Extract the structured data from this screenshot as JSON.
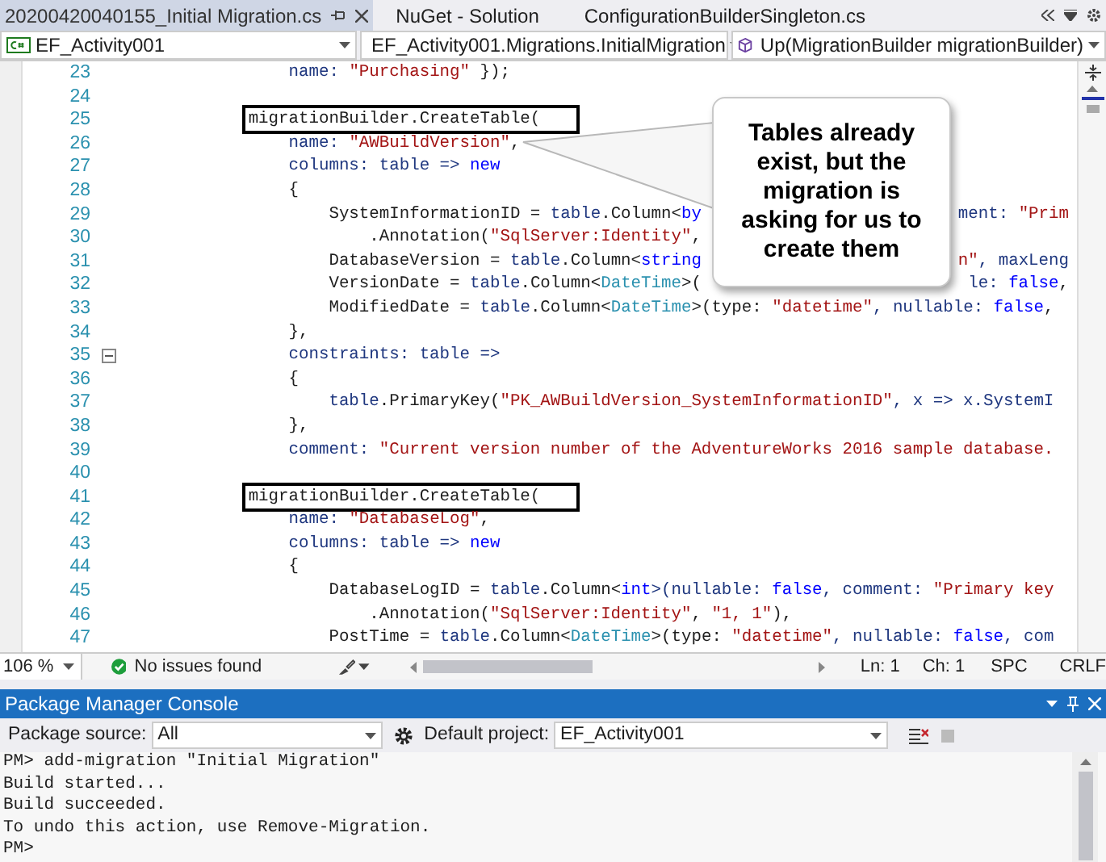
{
  "tabs": [
    {
      "label": "20200420040155_Initial Migration.cs",
      "selected": true
    },
    {
      "label": "NuGet - Solution",
      "selected": false
    },
    {
      "label": "ConfigurationBuilderSingleton.cs",
      "selected": false
    }
  ],
  "navigation": [
    {
      "kind": "project",
      "text": "EF_Activity001"
    },
    {
      "kind": "class",
      "text": "EF_Activity001.Migrations.InitialMigration"
    },
    {
      "kind": "method",
      "text": "Up(MigrationBuilder migrationBuilder)"
    }
  ],
  "editor": {
    "lines": [
      {
        "number": "23",
        "fold": false,
        "boxed": false,
        "segments": [
          {
            "text": "                name: ",
            "kind": "param"
          },
          {
            "text": "\"Purchasing\"",
            "kind": "str"
          },
          {
            "text": " });",
            "kind": "plain"
          }
        ]
      },
      {
        "number": "24",
        "fold": false,
        "boxed": false
      },
      {
        "number": "25",
        "fold": false,
        "boxed": true,
        "segments": [
          {
            "text": "            migrationBuilder.CreateTable(",
            "kind": "plain"
          }
        ]
      },
      {
        "number": "26",
        "fold": false,
        "boxed": false,
        "segments": [
          {
            "text": "                name: ",
            "kind": "param"
          },
          {
            "text": "\"AWBuildVersion\"",
            "kind": "str"
          },
          {
            "text": ",",
            "kind": "plain"
          }
        ]
      },
      {
        "number": "27",
        "fold": false,
        "boxed": false,
        "segments": [
          {
            "text": "                columns: table => ",
            "kind": "param"
          },
          {
            "text": "new",
            "kind": "kw"
          }
        ]
      },
      {
        "number": "28",
        "fold": false,
        "boxed": false,
        "segments": [
          {
            "text": "                {",
            "kind": "plain"
          }
        ]
      },
      {
        "number": "29",
        "fold": false,
        "boxed": false,
        "segments": [
          {
            "text": "                    SystemInformationID = ",
            "kind": "plain"
          },
          {
            "text": "table",
            "kind": "param"
          },
          {
            "text": ".Column<",
            "kind": "plain"
          },
          {
            "text": "by",
            "kind": "kw"
          }
        ],
        "right_segments": [
          {
            "text": "ment: ",
            "kind": "param"
          },
          {
            "text": "\"Prim",
            "kind": "str"
          }
        ]
      },
      {
        "number": "30",
        "fold": false,
        "boxed": false,
        "segments": [
          {
            "text": "                        .Annotation(",
            "kind": "plain"
          },
          {
            "text": "\"SqlServer:Identity\"",
            "kind": "str"
          },
          {
            "text": ",",
            "kind": "plain"
          }
        ]
      },
      {
        "number": "31",
        "fold": false,
        "boxed": false,
        "segments": [
          {
            "text": "                    DatabaseVersion = ",
            "kind": "plain"
          },
          {
            "text": "table",
            "kind": "param"
          },
          {
            "text": ".Column<",
            "kind": "plain"
          },
          {
            "text": "string",
            "kind": "kw"
          }
        ],
        "right_segments": [
          {
            "text": "n\"",
            "kind": "str"
          },
          {
            "text": ", maxLeng",
            "kind": "param"
          }
        ]
      },
      {
        "number": "32",
        "fold": false,
        "boxed": false,
        "segments": [
          {
            "text": "                    VersionDate = ",
            "kind": "plain"
          },
          {
            "text": "table",
            "kind": "param"
          },
          {
            "text": ".Column<",
            "kind": "plain"
          },
          {
            "text": "DateTime",
            "kind": "type"
          },
          {
            "text": ">(",
            "kind": "plain"
          }
        ],
        "right_segments": [
          {
            "text": "le: ",
            "kind": "param"
          },
          {
            "text": "false",
            "kind": "kw"
          },
          {
            "text": ",",
            "kind": "plain"
          }
        ]
      },
      {
        "number": "33",
        "fold": false,
        "boxed": false,
        "segments": [
          {
            "text": "                    ModifiedDate = ",
            "kind": "plain"
          },
          {
            "text": "table",
            "kind": "param"
          },
          {
            "text": ".Column<",
            "kind": "plain"
          },
          {
            "text": "DateTime",
            "kind": "type"
          },
          {
            "text": ">(type: ",
            "kind": "plain"
          },
          {
            "text": "\"datetime\"",
            "kind": "str"
          },
          {
            "text": ", nullable: ",
            "kind": "param"
          },
          {
            "text": "false",
            "kind": "kw"
          },
          {
            "text": ",",
            "kind": "plain"
          }
        ]
      },
      {
        "number": "34",
        "fold": false,
        "boxed": false,
        "segments": [
          {
            "text": "                },",
            "kind": "plain"
          }
        ]
      },
      {
        "number": "35",
        "fold": true,
        "boxed": false,
        "segments": [
          {
            "text": "                constraints: table =>",
            "kind": "param"
          }
        ]
      },
      {
        "number": "36",
        "fold": false,
        "boxed": false,
        "segments": [
          {
            "text": "                {",
            "kind": "plain"
          }
        ]
      },
      {
        "number": "37",
        "fold": false,
        "boxed": false,
        "segments": [
          {
            "text": "                    table",
            "kind": "param"
          },
          {
            "text": ".PrimaryKey(",
            "kind": "plain"
          },
          {
            "text": "\"PK_AWBuildVersion_SystemInformationID\"",
            "kind": "str"
          },
          {
            "text": ", x => x.SystemI",
            "kind": "param"
          }
        ]
      },
      {
        "number": "38",
        "fold": false,
        "boxed": false,
        "segments": [
          {
            "text": "                },",
            "kind": "plain"
          }
        ]
      },
      {
        "number": "39",
        "fold": false,
        "boxed": false,
        "segments": [
          {
            "text": "                comment: ",
            "kind": "param"
          },
          {
            "text": "\"Current version number of the AdventureWorks 2016 sample database.",
            "kind": "str"
          }
        ]
      },
      {
        "number": "40",
        "fold": false,
        "boxed": false
      },
      {
        "number": "41",
        "fold": false,
        "boxed": true,
        "segments": [
          {
            "text": "            migrationBuilder.CreateTable(",
            "kind": "plain"
          }
        ]
      },
      {
        "number": "42",
        "fold": false,
        "boxed": false,
        "segments": [
          {
            "text": "                name: ",
            "kind": "param"
          },
          {
            "text": "\"DatabaseLog\"",
            "kind": "str"
          },
          {
            "text": ",",
            "kind": "plain"
          }
        ]
      },
      {
        "number": "43",
        "fold": false,
        "boxed": false,
        "segments": [
          {
            "text": "                columns: table => ",
            "kind": "param"
          },
          {
            "text": "new",
            "kind": "kw"
          }
        ]
      },
      {
        "number": "44",
        "fold": false,
        "boxed": false,
        "segments": [
          {
            "text": "                {",
            "kind": "plain"
          }
        ]
      },
      {
        "number": "45",
        "fold": false,
        "boxed": false,
        "segments": [
          {
            "text": "                    DatabaseLogID = ",
            "kind": "plain"
          },
          {
            "text": "table",
            "kind": "param"
          },
          {
            "text": ".Column<",
            "kind": "plain"
          },
          {
            "text": "int",
            "kind": "kw"
          },
          {
            "text": ">(nullable: ",
            "kind": "param"
          },
          {
            "text": "false",
            "kind": "kw"
          },
          {
            "text": ", comment: ",
            "kind": "param"
          },
          {
            "text": "\"Primary key",
            "kind": "str"
          }
        ]
      },
      {
        "number": "46",
        "fold": false,
        "boxed": false,
        "segments": [
          {
            "text": "                        .Annotation(",
            "kind": "plain"
          },
          {
            "text": "\"SqlServer:Identity\"",
            "kind": "str"
          },
          {
            "text": ", ",
            "kind": "plain"
          },
          {
            "text": "\"1, 1\"",
            "kind": "str"
          },
          {
            "text": "),",
            "kind": "plain"
          }
        ]
      },
      {
        "number": "47",
        "fold": false,
        "boxed": false,
        "segments": [
          {
            "text": "                    PostTime = ",
            "kind": "plain"
          },
          {
            "text": "table",
            "kind": "param"
          },
          {
            "text": ".Column<",
            "kind": "plain"
          },
          {
            "text": "DateTime",
            "kind": "type"
          },
          {
            "text": ">(type: ",
            "kind": "plain"
          },
          {
            "text": "\"datetime\"",
            "kind": "str"
          },
          {
            "text": ", nullable: ",
            "kind": "param"
          },
          {
            "text": "false",
            "kind": "kw"
          },
          {
            "text": ", com",
            "kind": "param"
          }
        ]
      }
    ],
    "callout": "Tables already exist, but the migration is asking for us to create them"
  },
  "status_bar": {
    "zoom": "106 %",
    "issues": "No issues found",
    "line": "Ln: 1",
    "column": "Ch: 1",
    "whitespace": "SPC",
    "line_ending": "CRLF"
  },
  "console": {
    "title": "Package Manager Console",
    "package_source": {
      "label": "Package source:",
      "value": "All"
    },
    "default_project": {
      "label": "Default project:",
      "value": "EF_Activity001"
    },
    "lines": [
      "PM> add-migration \"Initial Migration\"",
      "Build started...",
      "Build succeeded.",
      "To undo this action, use Remove-Migration.",
      "PM>"
    ]
  }
}
